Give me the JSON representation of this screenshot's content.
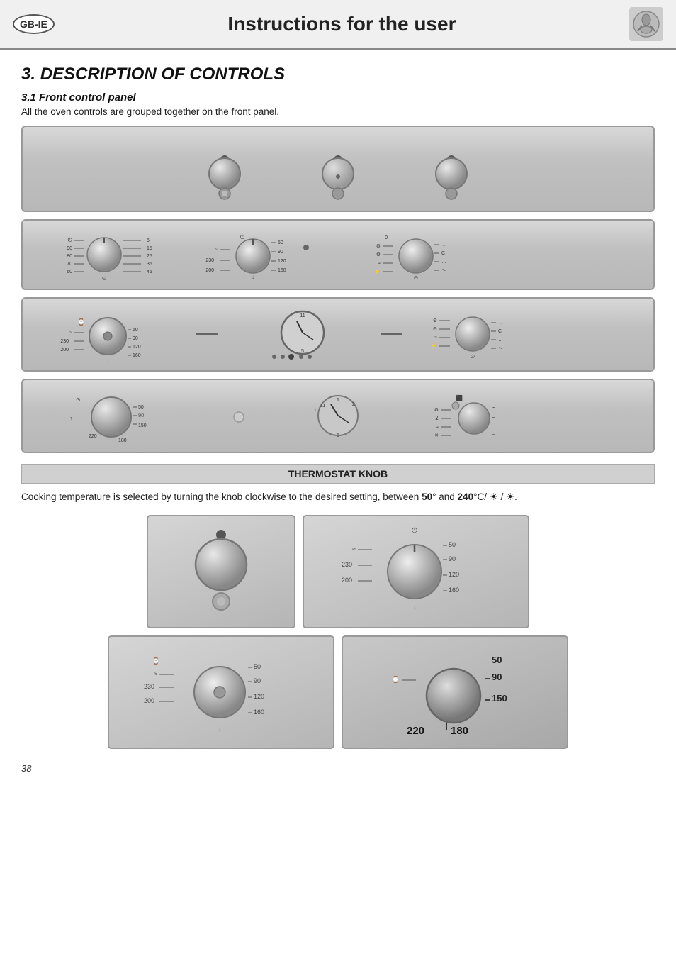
{
  "header": {
    "logo": "GB-IE",
    "title": "Instructions for the user",
    "icon": "🔧"
  },
  "section": {
    "number": "3.",
    "title": "DESCRIPTION OF CONTROLS",
    "subsection_number": "3.1",
    "subsection_title": "Front control panel",
    "subsection_text": "All the oven controls are grouped together on the front panel."
  },
  "thermostat": {
    "header": "THERMOSTAT KNOB",
    "text_prefix": "Cooking temperature is selected by turning the knob clockwise to the desired setting, between ",
    "bold1": "50",
    "text_mid": "° and ",
    "bold2": "240",
    "text_suffix": "°C/ ☀ / ☀."
  },
  "page_number": "38",
  "dial_labels": {
    "left1": [
      "90",
      "80",
      "70",
      "60"
    ],
    "right1": [
      "5",
      "15",
      "25",
      "35",
      "45"
    ],
    "left2": [
      "230",
      "200"
    ],
    "right2": [
      "50",
      "90",
      "120",
      "160"
    ],
    "left3": [
      "230",
      "200"
    ],
    "right3": [
      "50",
      "90",
      "120",
      "160"
    ],
    "bottom_left": [
      "220",
      "180"
    ],
    "bottom_right": [
      "50",
      "90",
      "150",
      "180"
    ]
  }
}
